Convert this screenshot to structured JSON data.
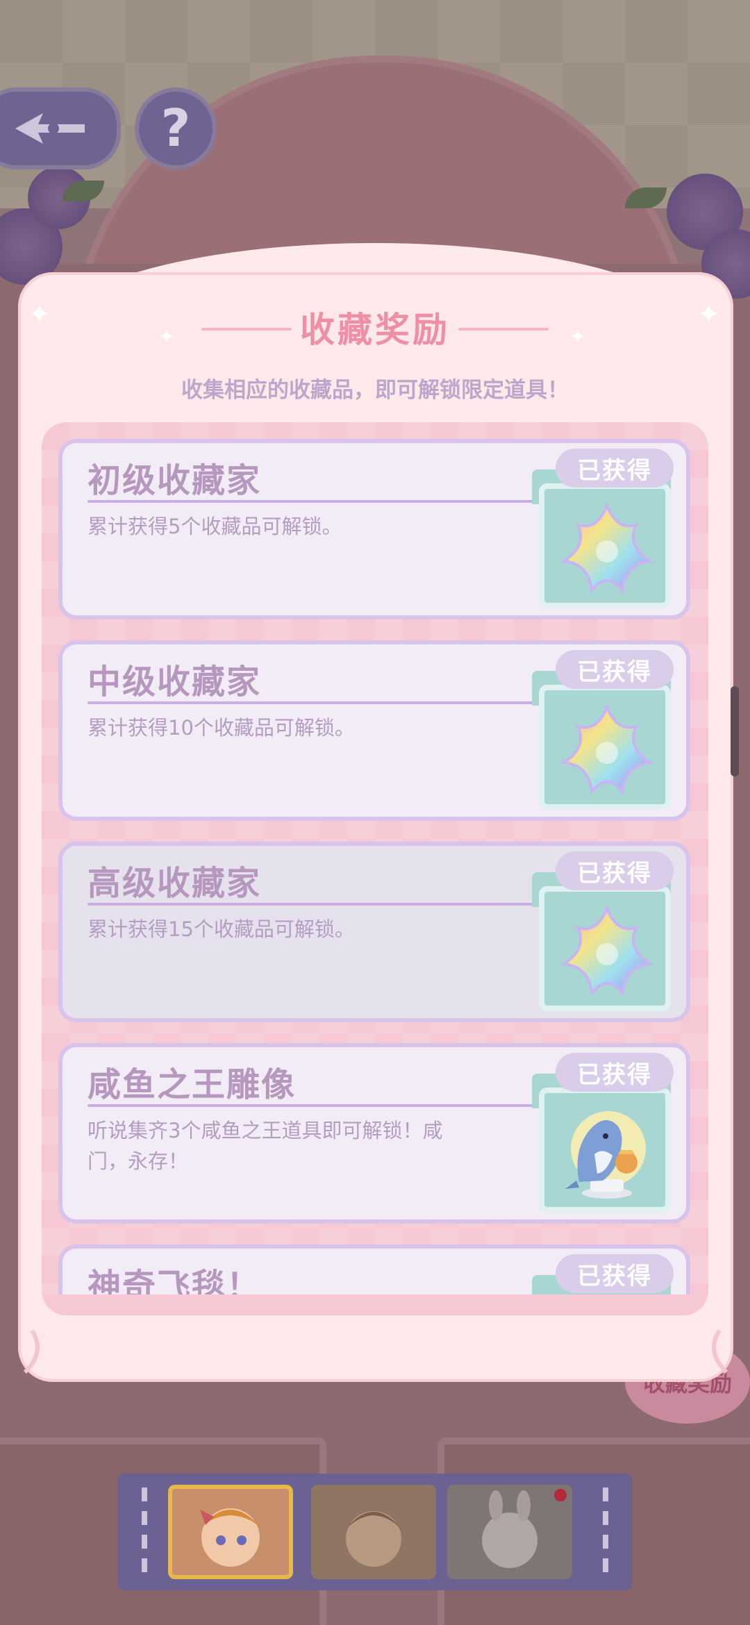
{
  "modal": {
    "title": "收藏奖励",
    "subtitle": "收集相应的收藏品，即可解锁限定道具！"
  },
  "cards": [
    {
      "title": "初级收藏家",
      "desc": "累计获得5个收藏品可解锁。",
      "badge": "已获得",
      "reward_icon": "rainbow-star-icon"
    },
    {
      "title": "中级收藏家",
      "desc": "累计获得10个收藏品可解锁。",
      "badge": "已获得",
      "reward_icon": "rainbow-star-icon"
    },
    {
      "title": "高级收藏家",
      "desc": "累计获得15个收藏品可解锁。",
      "badge": "已获得",
      "reward_icon": "rainbow-star-icon"
    },
    {
      "title": "咸鱼之王雕像",
      "desc": "听说集齐3个咸鱼之王道具即可解锁！咸门，永存！",
      "badge": "已获得",
      "reward_icon": "salted-fish-statue-icon"
    },
    {
      "title": "神奇飞毯！",
      "desc": "",
      "badge": "已获得",
      "reward_icon": "flying-carpet-icon"
    }
  ],
  "background": {
    "stamp_text": "收藏奖励"
  },
  "colors": {
    "modal_bg": "#fde8ea",
    "title_pink": "#ee8fa6",
    "card_bg": "#f1ecf6",
    "card_border": "#d8c4ea",
    "reward_teal": "#a7d6d3",
    "badge_lilac": "#d9cdea"
  }
}
